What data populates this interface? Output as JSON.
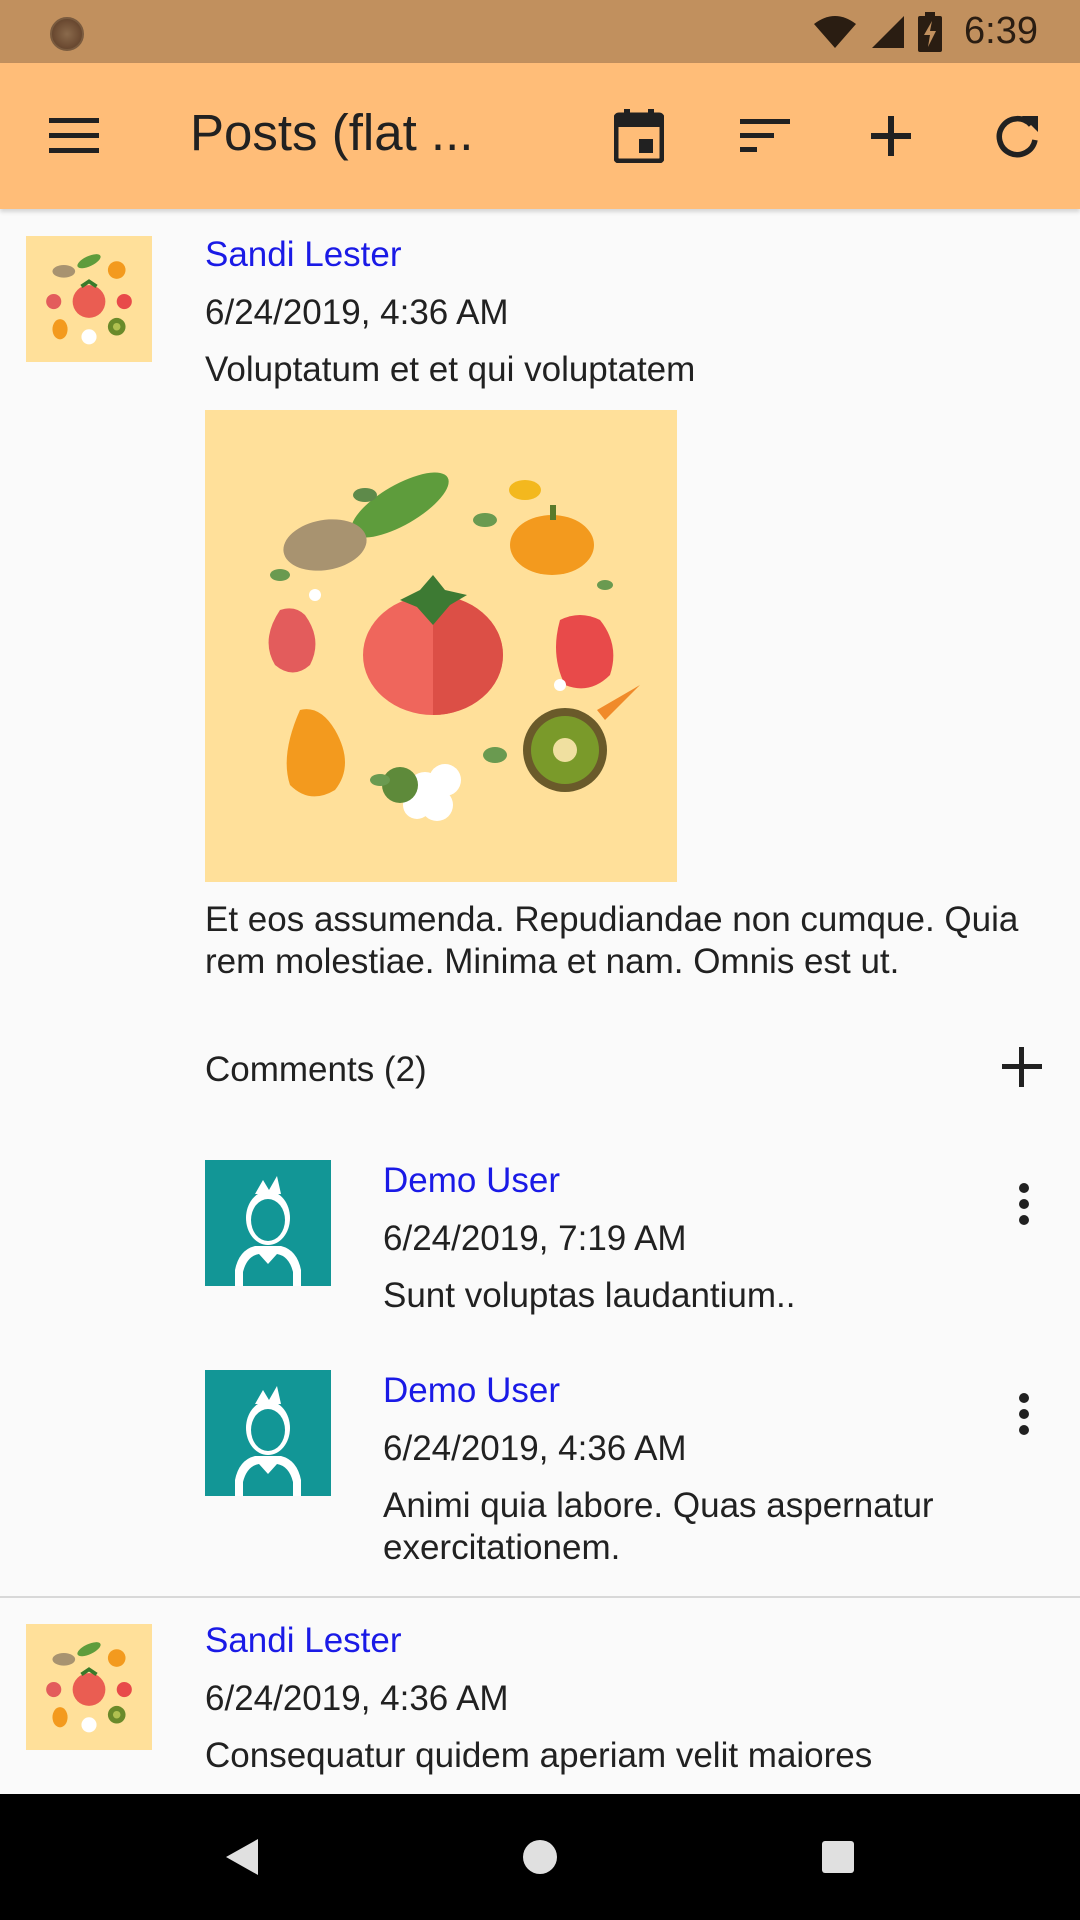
{
  "status_bar": {
    "time": "6:39",
    "icons": [
      "wifi-icon",
      "cell-signal-icon",
      "battery-charging-icon"
    ]
  },
  "app_bar": {
    "title": "Posts (flat ...",
    "icons": [
      "menu-icon",
      "calendar-icon",
      "sort-icon",
      "add-icon",
      "refresh-icon"
    ]
  },
  "posts": [
    {
      "author": "Sandi Lester",
      "date": "6/24/2019, 4:36 AM",
      "title": "Voluptatum et et qui voluptatem",
      "body": "Et eos assumenda. Repudiandae non cumque. Quia rem molestiae. Minima et nam. Omnis est ut.",
      "comments_label": "Comments (2)",
      "comments": [
        {
          "author": "Demo User",
          "date": "6/24/2019, 7:19 AM",
          "text": "Sunt voluptas laudantium.."
        },
        {
          "author": "Demo User",
          "date": "6/24/2019, 4:36 AM",
          "text": "Animi quia labore. Quas aspernatur exercitationem."
        }
      ]
    },
    {
      "author": "Sandi Lester",
      "date": "6/24/2019, 4:36 AM",
      "title": "Consequatur quidem aperiam velit maiores"
    }
  ],
  "nav_bar": {
    "icons": [
      "back-icon",
      "home-icon",
      "recents-icon"
    ]
  },
  "colors": {
    "status_bar": "#c1905e",
    "app_bar": "#ffbd78",
    "link": "#1a1ae6",
    "avatar_bg": "#129696",
    "image_bg": "#ffe09a"
  }
}
